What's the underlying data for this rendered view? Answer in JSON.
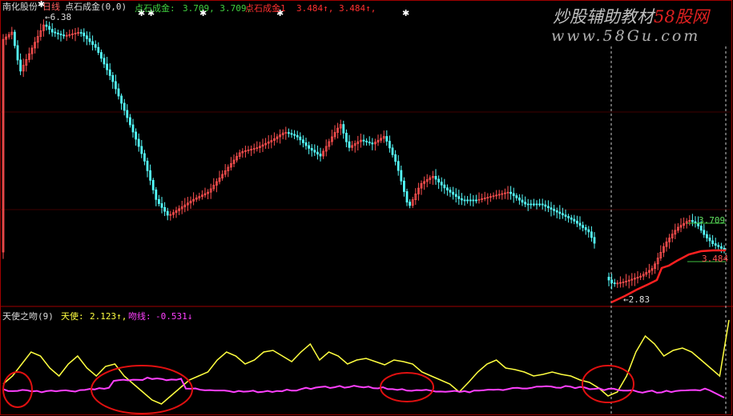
{
  "header": {
    "stock_name": "南化股份",
    "period": "日线",
    "main_indicator": "点石成金(0,0)",
    "line1_label": "点石成金:",
    "line1_values": "3.709, 3.709,",
    "line2_label": "点石成金1",
    "line2_values": "3.484↑, 3.484↑,"
  },
  "price_labels": {
    "high": "6.38",
    "low": "2.83",
    "upper_line": "3.709",
    "lower_line": "3.484"
  },
  "sub_header": {
    "indicator": "天使之吻(9)",
    "angel_label": "天使:",
    "angel_value": "2.123↑,",
    "kiss_label": "吻线:",
    "kiss_value": "-0.531↓"
  },
  "watermark": {
    "cn": "炒股辅助教材",
    "brand": "58股网",
    "url": "www.58Gu.com"
  },
  "colors": {
    "up": "#ff5050",
    "down": "#54fcfc",
    "angel": "#ffff40",
    "kiss": "#ff40ff",
    "signal_line": "#ff2020",
    "level_line": "#40c040",
    "frame": "#a00000"
  }
}
